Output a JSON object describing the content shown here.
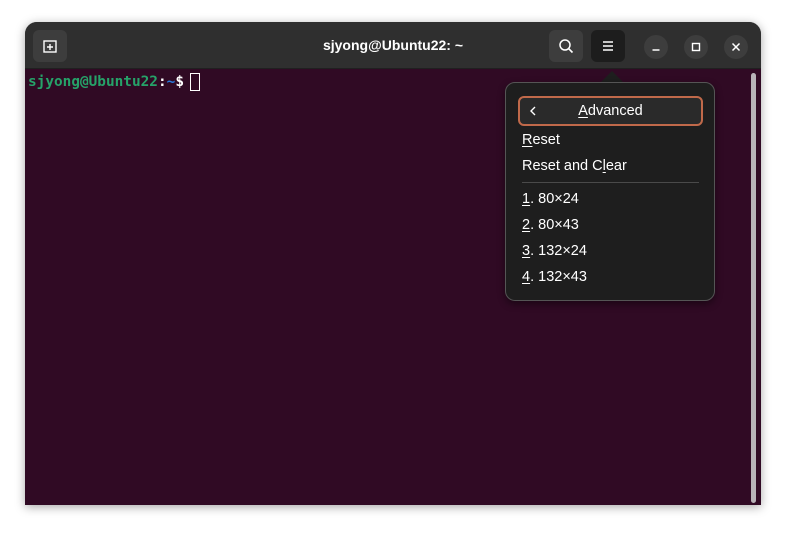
{
  "window": {
    "title": "sjyong@Ubuntu22: ~"
  },
  "terminal": {
    "prompt_user_host": "sjyong@Ubuntu22",
    "prompt_colon": ":",
    "prompt_path": "~",
    "prompt_symbol": "$"
  },
  "menu": {
    "header": {
      "label_mnemonic": "A",
      "label_rest": "dvanced"
    },
    "items": [
      {
        "mnemonic": "R",
        "rest": "eset"
      },
      {
        "pre": "Reset and C",
        "mnemonic": "l",
        "rest": "ear"
      },
      {
        "mnemonic": "1",
        "rest": ". 80×24"
      },
      {
        "mnemonic": "2",
        "rest": ". 80×43"
      },
      {
        "mnemonic": "3",
        "rest": ". 132×24"
      },
      {
        "mnemonic": "4",
        "rest": ". 132×43"
      }
    ]
  },
  "colors": {
    "terminal_bg": "#300a24",
    "prompt_user": "#26a269",
    "prompt_path": "#2a7bde",
    "focus_ring": "#c0694a"
  },
  "icons": {
    "new_tab": "new-tab-icon",
    "search": "search-icon",
    "menu": "hamburger-menu-icon",
    "minimize": "minimize-icon",
    "maximize": "maximize-icon",
    "close": "close-icon",
    "back": "chevron-left-icon"
  }
}
